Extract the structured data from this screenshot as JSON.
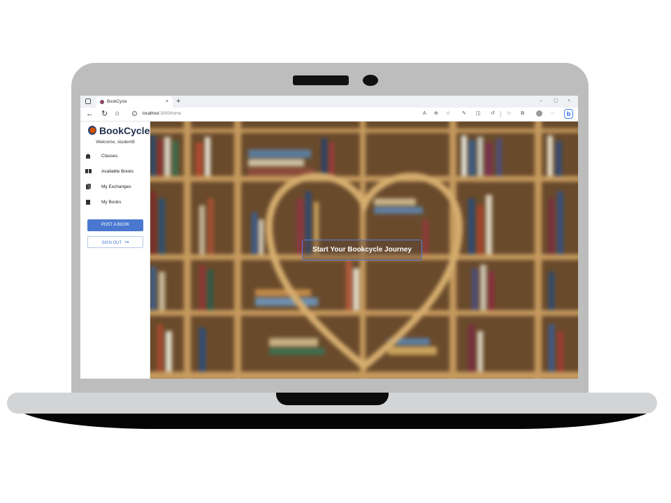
{
  "browser": {
    "tab_title": "BookCycle",
    "tab_close": "×",
    "new_tab": "+",
    "window_controls": {
      "minimize": "–",
      "restore": "▢",
      "close": "×"
    },
    "url_host": "localhost",
    "url_path": ":3000/home",
    "icons": [
      "read-aloud-icon",
      "zoom-icon",
      "favorite-icon",
      "extension-icon",
      "split-screen-icon",
      "refresh-icon",
      "favorites-icon",
      "collections-icon",
      "profile-icon",
      "more-icon",
      "bing-icon"
    ]
  },
  "sidebar": {
    "brand": "BookCycle",
    "welcome": "Welcome, student9",
    "items": [
      {
        "label": "Classes",
        "icon": "classes-icon"
      },
      {
        "label": "Available Books",
        "icon": "open-book-icon"
      },
      {
        "label": "My Exchanges",
        "icon": "exchange-icon"
      },
      {
        "label": "My Books",
        "icon": "book-icon"
      }
    ],
    "post_button": "POST A BOOK",
    "signout_button": "SIGN OUT"
  },
  "hero": {
    "cta": "Start Your Bookcycle Journey"
  }
}
